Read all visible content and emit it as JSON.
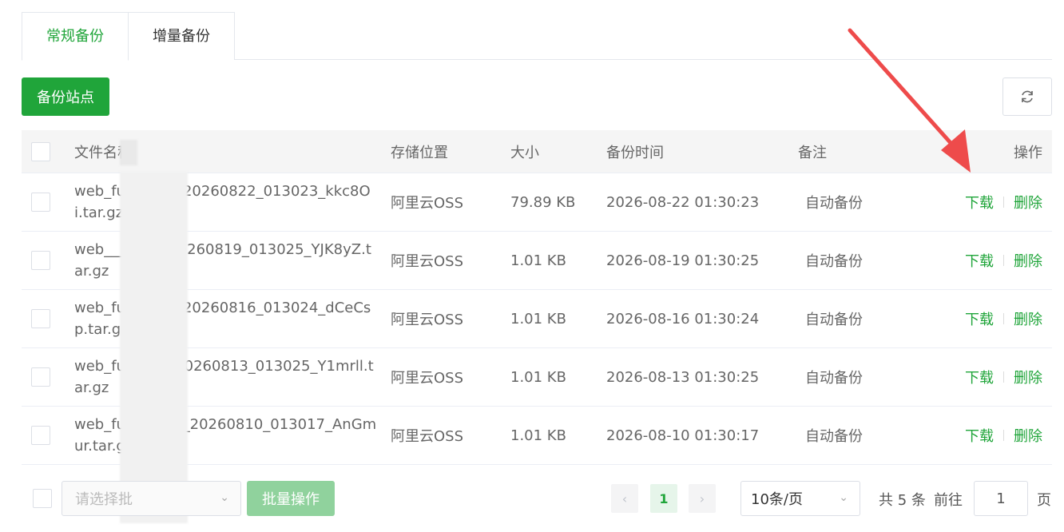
{
  "tabs": [
    {
      "label": "常规备份",
      "active": true
    },
    {
      "label": "增量备份",
      "active": false
    }
  ],
  "toolbar": {
    "backup_site_label": "备份站点",
    "refresh_icon": "refresh-icon"
  },
  "table": {
    "headers": {
      "name": "文件名称",
      "location": "存储位置",
      "size": "大小",
      "time": "备份时间",
      "note": "备注",
      "ops": "操作"
    },
    "rows": [
      {
        "name": "web_fu________20260822_013023_kkc8Oi.tar.gz",
        "location": "阿里云OSS",
        "size": "79.89 KB",
        "time": "2026-08-22 01:30:23",
        "note": "自动备份",
        "download": "下载",
        "delete": "删除"
      },
      {
        "name": "web_________20260819_013025_YJK8yZ.tar.gz",
        "location": "阿里云OSS",
        "size": "1.01 KB",
        "time": "2026-08-19 01:30:25",
        "note": "自动备份",
        "download": "下载",
        "delete": "删除"
      },
      {
        "name": "web_fu________20260816_013024_dCeCsp.tar.gz",
        "location": "阿里云OSS",
        "size": "1.01 KB",
        "time": "2026-08-16 01:30:24",
        "note": "自动备份",
        "download": "下载",
        "delete": "删除"
      },
      {
        "name": "web_fuy_______0260813_013025_Y1mrll.tar.gz",
        "location": "阿里云OSS",
        "size": "1.01 KB",
        "time": "2026-08-13 01:30:25",
        "note": "自动备份",
        "download": "下载",
        "delete": "删除"
      },
      {
        "name": "web_fuya_____i_20260810_013017_AnGmur.tar.gz",
        "location": "阿里云OSS",
        "size": "1.01 KB",
        "time": "2026-08-10 01:30:17",
        "note": "自动备份",
        "download": "下载",
        "delete": "删除"
      }
    ]
  },
  "footer": {
    "batch_placeholder": "请选择批",
    "batch_button": "批量操作",
    "current_page": "1",
    "page_size": "10条/页",
    "total": "共 5 条",
    "goto_label": "前往",
    "goto_value": "1",
    "page_unit": "页"
  },
  "colors": {
    "accent": "#20a53a",
    "arrow": "#ee4b4b"
  }
}
